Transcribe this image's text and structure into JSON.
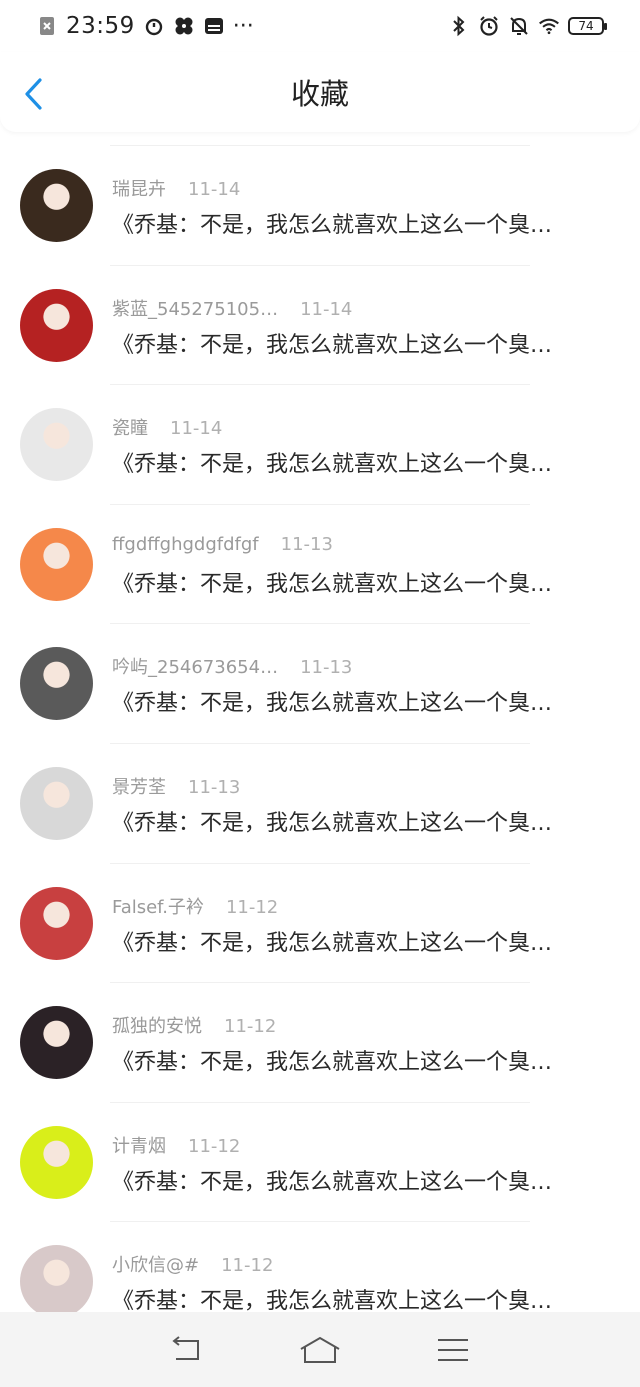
{
  "status_bar": {
    "time": "23:59",
    "dots": "···",
    "battery": "74"
  },
  "header": {
    "title": "收藏"
  },
  "items": [
    {
      "name": "瑞昆卉",
      "date": "11-14",
      "content": "《乔基：不是，我怎么就喜欢上这么一个臭…",
      "avatar_color": "#3a2a1e"
    },
    {
      "name": "紫蓝_545275105…",
      "date": "11-14",
      "content": "《乔基：不是，我怎么就喜欢上这么一个臭…",
      "avatar_color": "#b52222"
    },
    {
      "name": "瓷瞳",
      "date": "11-14",
      "content": "《乔基：不是，我怎么就喜欢上这么一个臭…",
      "avatar_color": "#e8e8e8"
    },
    {
      "name": "ffgdffghgdgfdfgf",
      "date": "11-13",
      "content": "《乔基：不是，我怎么就喜欢上这么一个臭…",
      "avatar_color": "#f5884a"
    },
    {
      "name": "吟屿_254673654…",
      "date": "11-13",
      "content": "《乔基：不是，我怎么就喜欢上这么一个臭…",
      "avatar_color": "#5a5a5a"
    },
    {
      "name": "景芳荃",
      "date": "11-13",
      "content": "《乔基：不是，我怎么就喜欢上这么一个臭…",
      "avatar_color": "#d8d8d8"
    },
    {
      "name": "Falsef.子衿",
      "date": "11-12",
      "content": "《乔基：不是，我怎么就喜欢上这么一个臭…",
      "avatar_color": "#c84040"
    },
    {
      "name": "孤独的安悦",
      "date": "11-12",
      "content": "《乔基：不是，我怎么就喜欢上这么一个臭…",
      "avatar_color": "#2b2226"
    },
    {
      "name": "计青烟",
      "date": "11-12",
      "content": "《乔基：不是，我怎么就喜欢上这么一个臭…",
      "avatar_color": "#d9ee1a"
    },
    {
      "name": "小欣信@#",
      "date": "11-12",
      "content": "《乔基：不是，我怎么就喜欢上这么一个臭…",
      "avatar_color": "#d8c9c9"
    }
  ],
  "colors": {
    "accent": "#1e90e6"
  }
}
